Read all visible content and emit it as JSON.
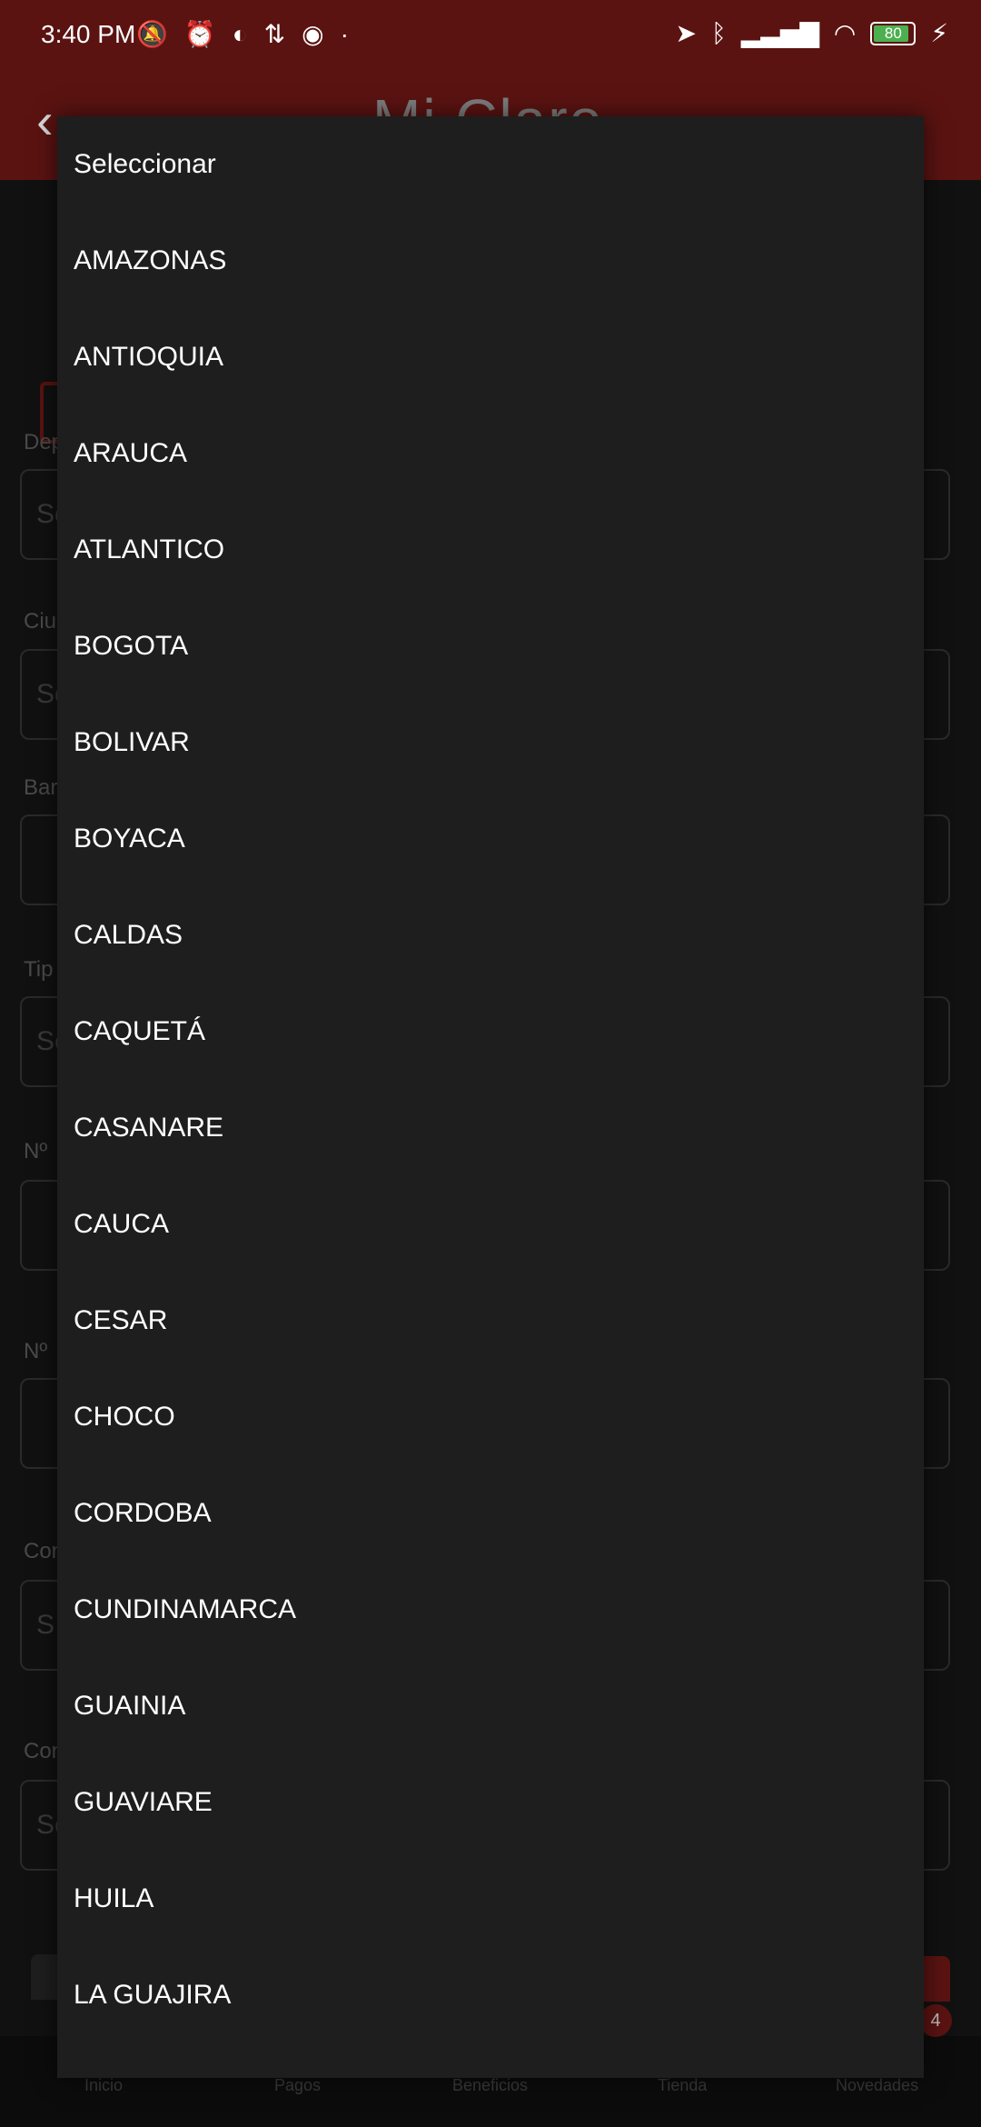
{
  "status_bar": {
    "time": "3:40 PM",
    "battery": "80",
    "left_icons": [
      "notifications-off-icon",
      "alarm-icon",
      "app-icon",
      "data-transfer-icon",
      "sync-icon",
      "dot-icon"
    ],
    "right_icons": [
      "location-icon",
      "bluetooth-icon",
      "signal-icon",
      "wifi-icon",
      "battery-icon",
      "charging-icon"
    ]
  },
  "header": {
    "logo_text": "Mi Claro"
  },
  "form": {
    "fields": [
      {
        "label": "Dep",
        "value": "Se"
      },
      {
        "label": "Ciu",
        "value": "Se"
      },
      {
        "label": "Bar",
        "value": ""
      },
      {
        "label": "Tip",
        "value": "Se"
      },
      {
        "label": "Nº",
        "value": ""
      },
      {
        "label": "Nº",
        "value": ""
      },
      {
        "label": "Con",
        "value": "S"
      },
      {
        "label": "Con",
        "value": "Se"
      }
    ]
  },
  "dropdown": {
    "options": [
      "Seleccionar",
      "AMAZONAS",
      "ANTIOQUIA",
      "ARAUCA",
      "ATLANTICO",
      "BOGOTA",
      "BOLIVAR",
      "BOYACA",
      "CALDAS",
      "CAQUETÁ",
      "CASANARE",
      "CAUCA",
      "CESAR",
      "CHOCO",
      "CORDOBA",
      "CUNDINAMARCA",
      "GUAINIA",
      "GUAVIARE",
      "HUILA",
      "LA GUAJIRA"
    ]
  },
  "bottom_nav": {
    "items": [
      "Inicio",
      "Pagos",
      "Beneficios",
      "Tienda",
      "Novedades"
    ],
    "badge": "4"
  },
  "colors": {
    "brand_dim": "#5a1311",
    "dropdown_bg": "#1e1e1e",
    "option_text": "#ffffff"
  }
}
